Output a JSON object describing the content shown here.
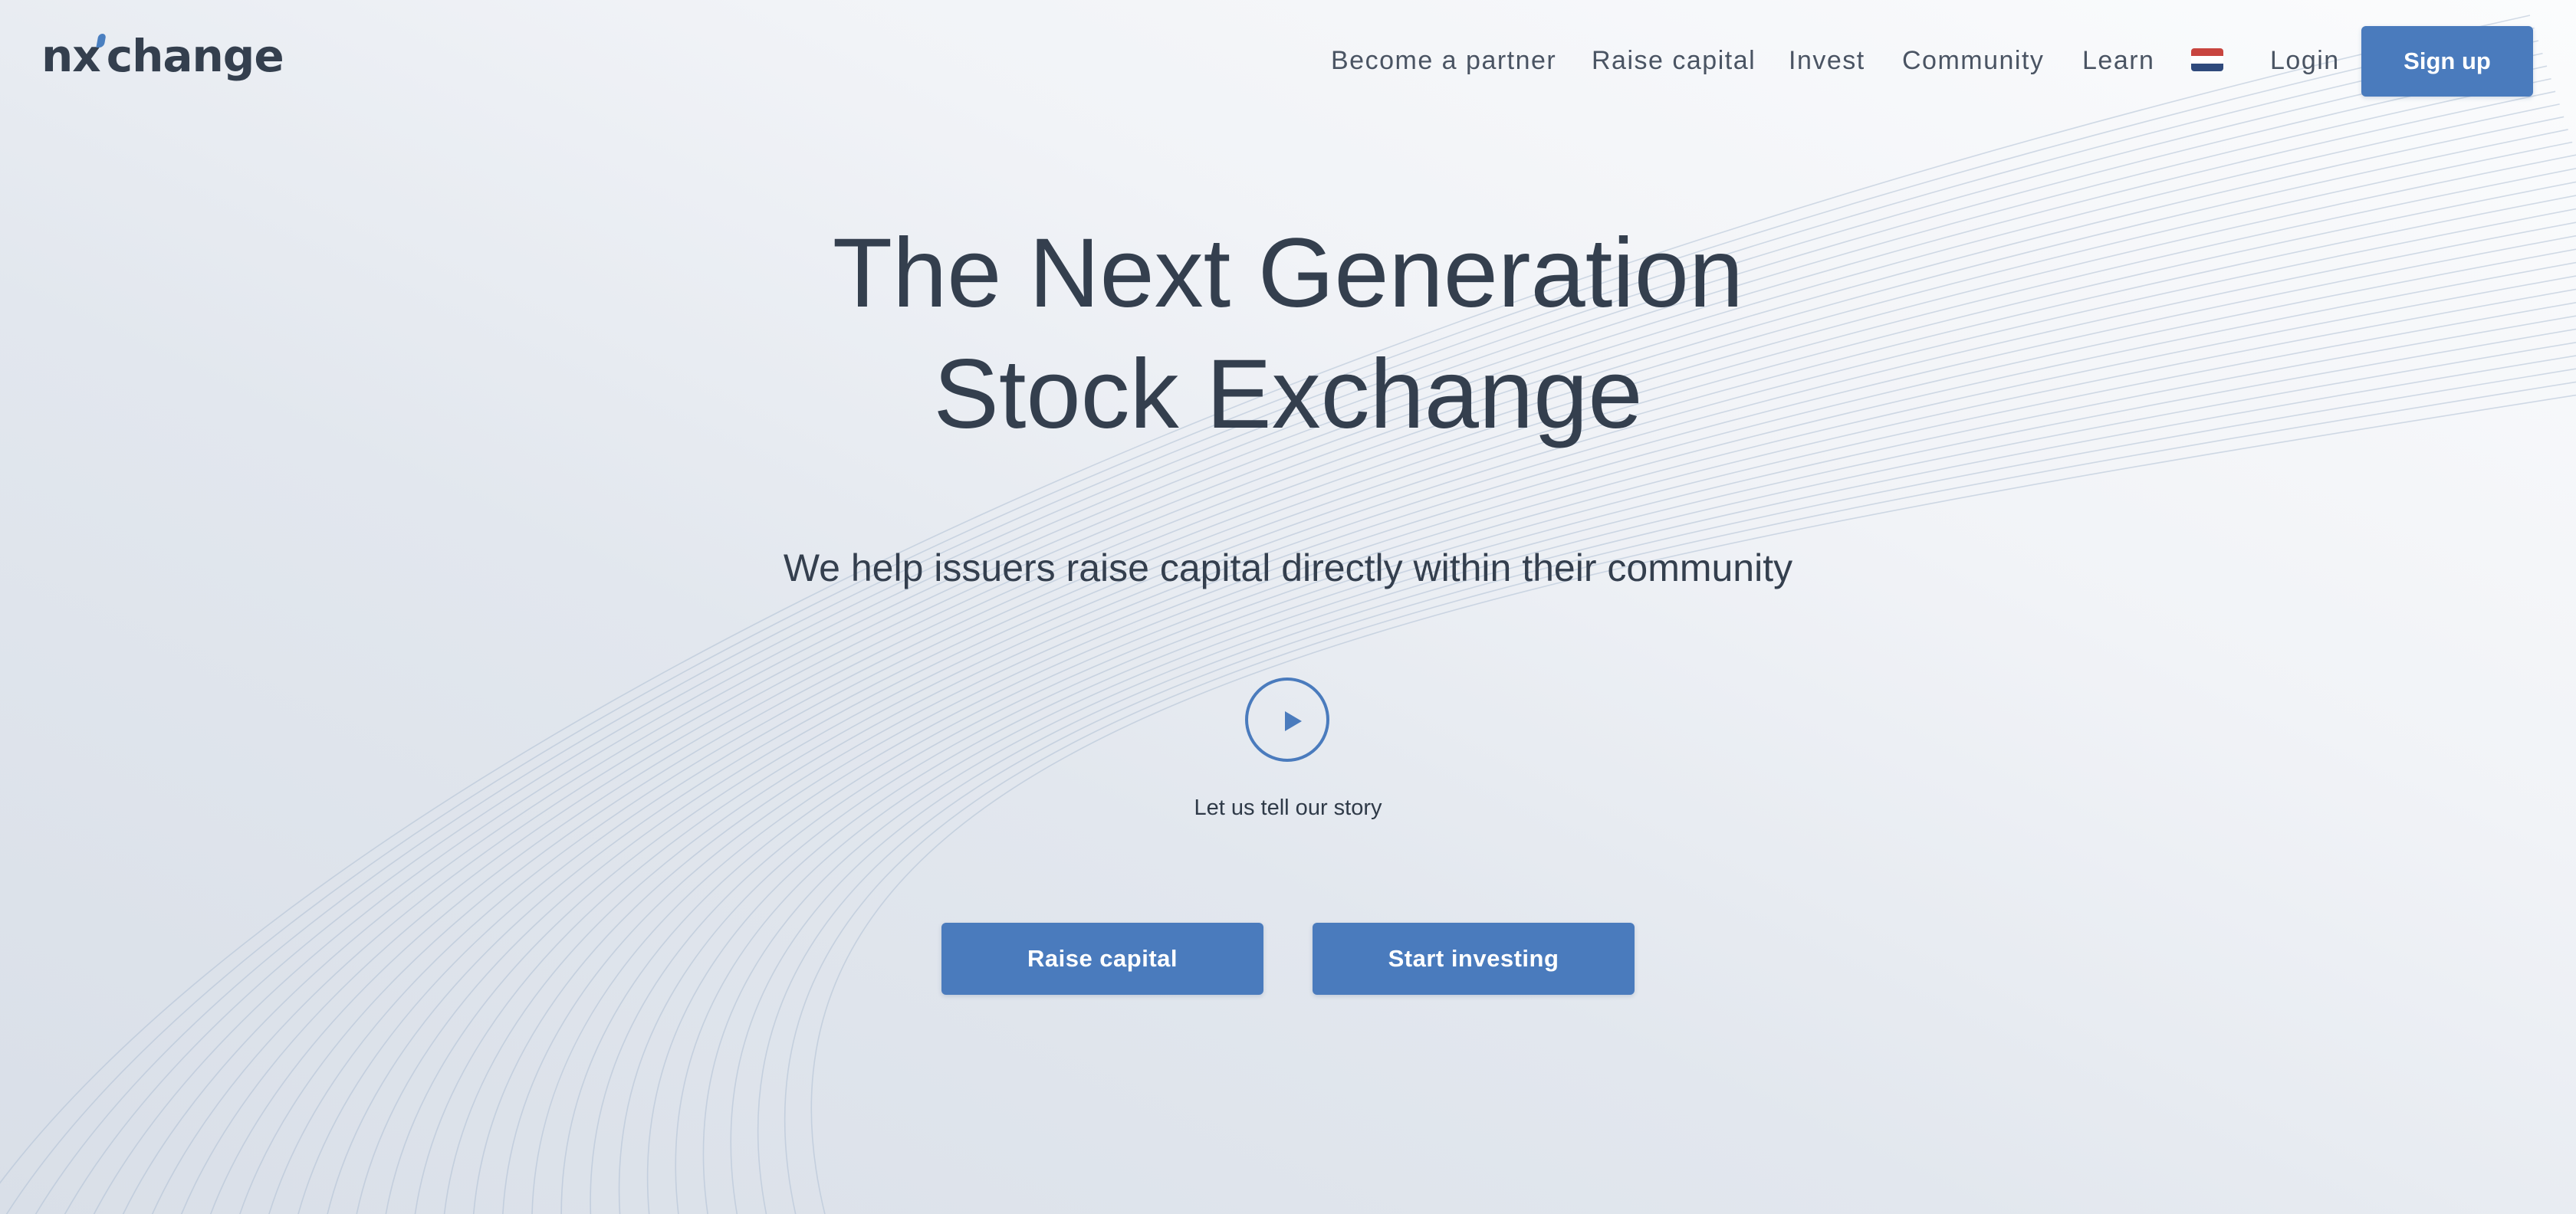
{
  "logo": {
    "text_left": "nx",
    "text_right": "change"
  },
  "nav": {
    "items": [
      {
        "label": "Become a partner"
      },
      {
        "label": "Raise capital"
      },
      {
        "label": "Invest"
      },
      {
        "label": "Community"
      },
      {
        "label": "Learn"
      }
    ],
    "language_icon": "netherlands-flag-icon",
    "login_label": "Login",
    "signup_label": "Sign up"
  },
  "hero": {
    "title_line1": "The Next Generation",
    "title_line2": "Stock Exchange",
    "subtitle": "We help issuers raise capital directly within their community",
    "play_icon": "play-icon",
    "story_label": "Let us tell our story",
    "raise_capital_label": "Raise capital",
    "start_investing_label": "Start investing"
  },
  "colors": {
    "accent": "#4a7bbd",
    "text_dark": "#343f4e",
    "flag_red": "#c8453f",
    "flag_white": "#ffffff",
    "flag_blue": "#2f4a7c"
  }
}
